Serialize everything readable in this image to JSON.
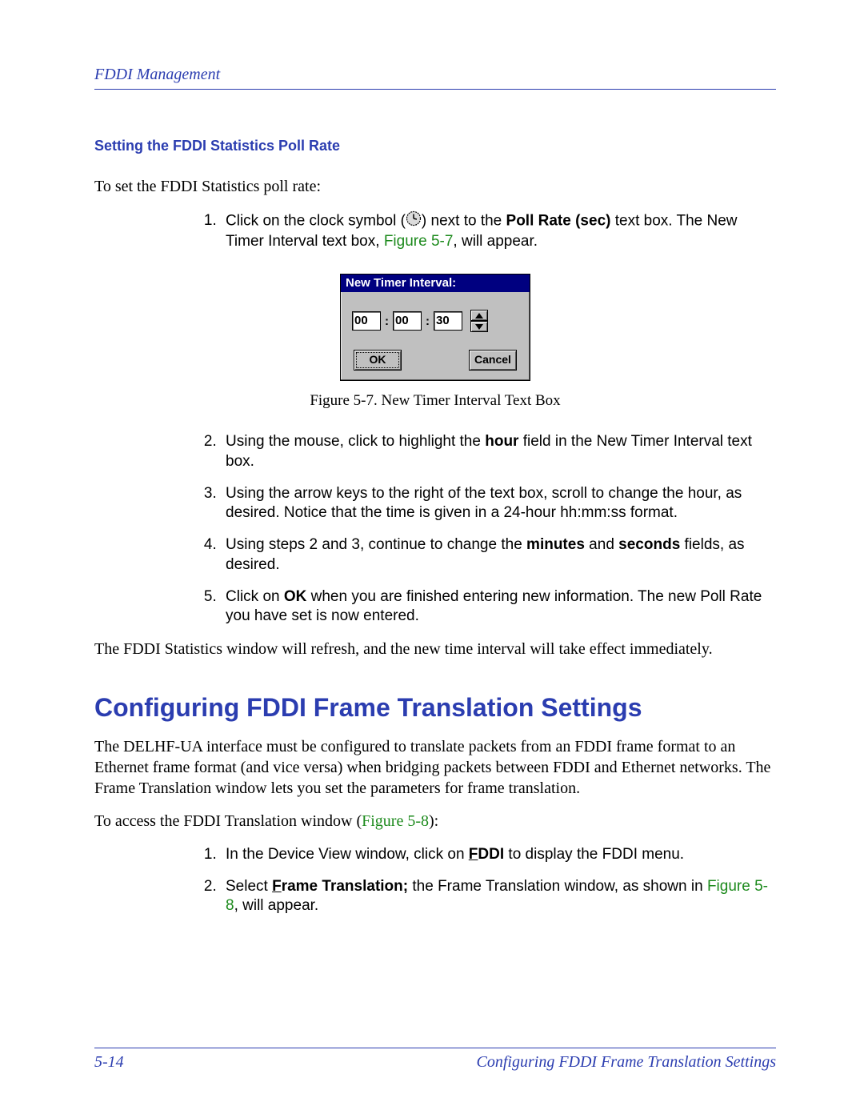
{
  "header": {
    "chapter": "FDDI Management"
  },
  "section": {
    "sub_heading": "Setting the FDDI Statistics Poll Rate",
    "intro": "To set the FDDI Statistics poll rate:",
    "step1_a": "Click on the clock symbol (",
    "step1_b": ") next to the ",
    "step1_bold": "Poll Rate (sec)",
    "step1_c": " text box. The New Timer Interval text box, ",
    "step1_figref": "Figure 5-7",
    "step1_d": ", will appear.",
    "step2_a": "Using the mouse, click to highlight the ",
    "step2_bold": "hour",
    "step2_b": " field in the New Timer Interval text box.",
    "step3": "Using the arrow keys to the right of the text box, scroll to change the hour, as desired. Notice that the time is given in a 24-hour hh:mm:ss format.",
    "step4_a": "Using steps 2 and 3, continue to change the ",
    "step4_bold1": "minutes",
    "step4_mid": " and ",
    "step4_bold2": "seconds",
    "step4_b": " fields, as desired.",
    "step5_a": "Click on ",
    "step5_bold": "OK",
    "step5_b": " when you are finished entering new information. The new Poll Rate you have set is now entered.",
    "after": "The FDDI Statistics window will refresh, and the new time interval will take effect immediately."
  },
  "dialog": {
    "title": "New Timer Interval:",
    "hh": "00",
    "mm": "00",
    "ss": "30",
    "ok": "OK",
    "cancel": "Cancel"
  },
  "figure_caption": "Figure 5-7. New Timer Interval Text Box",
  "h1": "Configuring FDDI Frame Translation Settings",
  "body2": {
    "p1": "The DELHF-UA interface must be configured to translate packets from an FDDI frame format to an Ethernet frame format (and vice versa) when bridging packets between FDDI and Ethernet networks. The Frame Translation window lets you set the parameters for frame translation.",
    "p2_a": "To access the FDDI Translation window (",
    "p2_fig": "Figure 5-8",
    "p2_b": "):",
    "s1_a": "In the Device View window, click on ",
    "s1_u": "F",
    "s1_bold_rest": "DDI",
    "s1_b": " to display the FDDI menu.",
    "s2_a": "Select ",
    "s2_u": "F",
    "s2_bold_rest": "rame Translation;",
    "s2_b": " the Frame Translation window, as shown in ",
    "s2_fig": "Figure 5-8",
    "s2_c": ", will appear."
  },
  "footer": {
    "page_num": "5-14",
    "section_title": "Configuring FDDI Frame Translation Settings"
  }
}
